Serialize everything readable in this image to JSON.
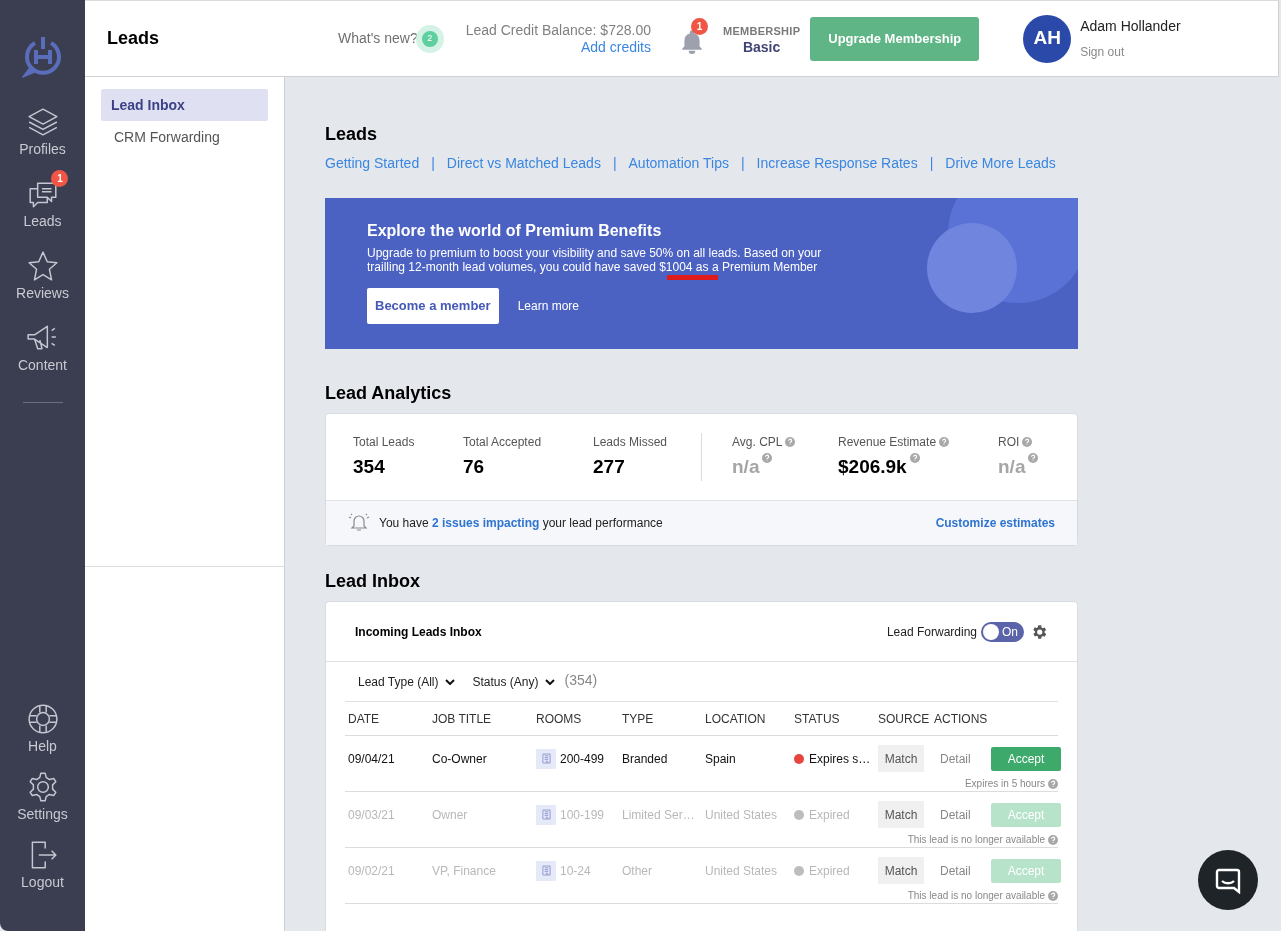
{
  "nav": {
    "items": [
      {
        "label": "Profiles"
      },
      {
        "label": "Leads",
        "badge": "1"
      },
      {
        "label": "Reviews"
      },
      {
        "label": "Content"
      }
    ],
    "bottom_items": [
      {
        "label": "Help"
      },
      {
        "label": "Settings"
      },
      {
        "label": "Logout"
      }
    ]
  },
  "header": {
    "title": "Leads",
    "whats_new": "What's new?",
    "whats_new_count": "2",
    "credit_label": "Lead Credit Balance: $728.00",
    "add_credits": "Add credits",
    "notifications": "1",
    "membership_label": "MEMBERSHIP",
    "membership_level": "Basic",
    "upgrade_button": "Upgrade Membership",
    "avatar_initials": "AH",
    "user_name": "Adam Hollander",
    "sign_out": "Sign out"
  },
  "submenu": [
    {
      "label": "Lead Inbox",
      "selected": true
    },
    {
      "label": "CRM Forwarding",
      "selected": false
    }
  ],
  "page_title": "Leads",
  "links": [
    "Getting Started",
    "Direct vs Matched Leads",
    "Automation Tips",
    "Increase Response Rates",
    "Drive More Leads"
  ],
  "link_separator": "|",
  "banner": {
    "title": "Explore the world of Premium Benefits",
    "text": "Upgrade to premium to boost your visibility and save 50% on all leads. Based on your trailling 12-month lead volumes, you could have saved $1004 as a Premium Member",
    "primary_button": "Become a member",
    "secondary_link": "Learn more"
  },
  "analytics": {
    "title": "Lead Analytics",
    "stats": [
      {
        "label": "Total Leads",
        "value": "354",
        "help": false,
        "muted": false
      },
      {
        "label": "Total Accepted",
        "value": "76",
        "help": false,
        "muted": false
      },
      {
        "label": "Leads Missed",
        "value": "277",
        "help": false,
        "muted": false
      },
      {
        "label": "Avg. CPL",
        "value": "n/a",
        "help": true,
        "muted": true
      },
      {
        "label": "Revenue Estimate",
        "value": "$206.9k",
        "help": true,
        "muted": false
      },
      {
        "label": "ROI",
        "value": "n/a",
        "help": true,
        "muted": true
      }
    ],
    "notice": "You have **2 issues impacting** your lead performance",
    "customize": "Customize estimates"
  },
  "inbox": {
    "title": "Lead Inbox",
    "card_title": "Incoming Leads Inbox",
    "forwarding_label": "Lead Forwarding",
    "forwarding": {
      "on": true,
      "text": "On"
    },
    "filters": [
      "Lead Type (All)",
      "Status (Any)"
    ],
    "count": "(354)",
    "columns": [
      "DATE",
      "JOB TITLE",
      "ROOMS",
      "TYPE",
      "LOCATION",
      "STATUS",
      "SOURCE",
      "ACTIONS"
    ],
    "rows": [
      {
        "date": "09/04/21",
        "job_title": "Co-Owner",
        "rooms": "200-499",
        "type": "Branded",
        "location": "Spain",
        "status": "Expires s…",
        "color": "#e5453d",
        "source": "Match",
        "detail": "Detail",
        "accept": "Accept",
        "note": "Expires in 5 hours",
        "disabled": false
      },
      {
        "date": "09/03/21",
        "job_title": "Owner",
        "rooms": "100-199",
        "type": "Limited Ser…",
        "location": "United States",
        "status": "Expired",
        "color": "#bdbdbd",
        "source": "Match",
        "detail": "Detail",
        "accept": "Accept",
        "note": "This lead is no longer available",
        "disabled": true
      },
      {
        "date": "09/02/21",
        "job_title": "VP, Finance",
        "rooms": "10-24",
        "type": "Other",
        "location": "United States",
        "status": "Expired",
        "color": "#bdbdbd",
        "source": "Match",
        "detail": "Detail",
        "accept": "Accept",
        "note": "This lead is no longer available",
        "disabled": true
      }
    ]
  }
}
